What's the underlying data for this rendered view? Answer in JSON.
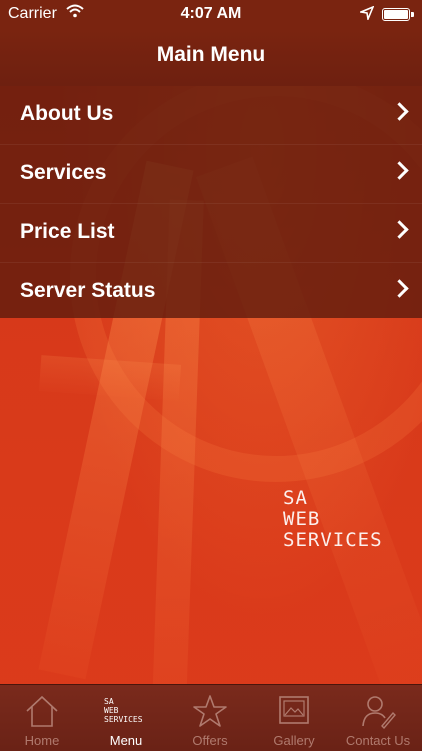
{
  "status_bar": {
    "carrier": "Carrier",
    "time": "4:07 AM"
  },
  "nav": {
    "title": "Main Menu"
  },
  "menu": {
    "items": [
      {
        "label": "About Us"
      },
      {
        "label": "Services"
      },
      {
        "label": "Price List"
      },
      {
        "label": "Server Status"
      }
    ]
  },
  "logo": {
    "line1": "SA",
    "line2": "WEB",
    "line3": "SERVICES"
  },
  "tabs": [
    {
      "label": "Home",
      "icon": "home-icon"
    },
    {
      "label": "Menu",
      "icon": "sa-web-services-logo"
    },
    {
      "label": "Offers",
      "icon": "star-icon"
    },
    {
      "label": "Gallery",
      "icon": "gallery-icon"
    },
    {
      "label": "Contact Us",
      "icon": "contact-icon"
    }
  ],
  "colors": {
    "background": "#d8391a",
    "bars": "#7a2410",
    "menu_overlay": "#601c0e"
  }
}
